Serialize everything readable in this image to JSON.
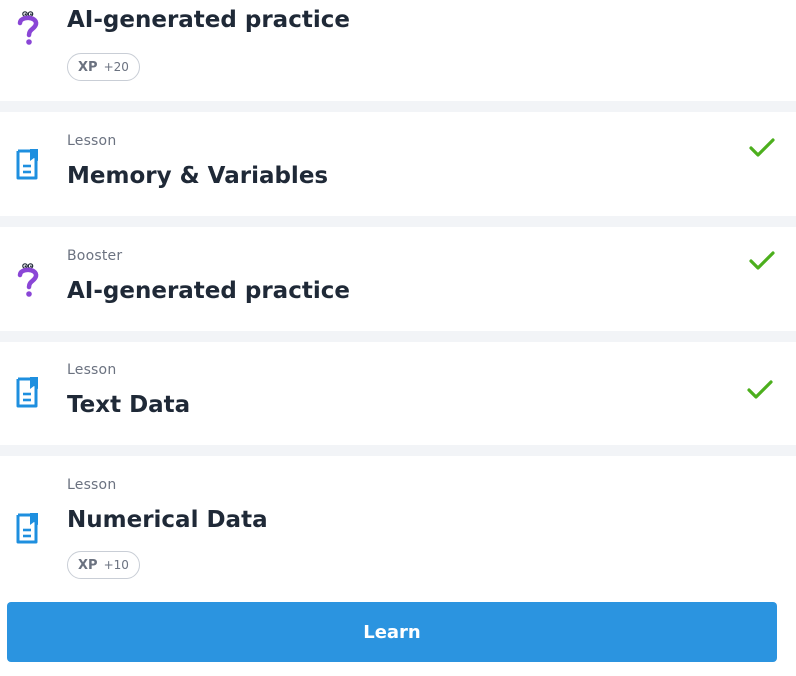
{
  "items": [
    {
      "type": "",
      "title": "AI-generated practice",
      "icon": "booster-question-icon",
      "xp": {
        "label": "XP",
        "value": "+20"
      },
      "completed": false
    },
    {
      "type": "Lesson",
      "title": "Memory & Variables",
      "icon": "lesson-document-icon",
      "completed": true
    },
    {
      "type": "Booster",
      "title": "AI-generated practice",
      "icon": "booster-question-icon",
      "completed": true
    },
    {
      "type": "Lesson",
      "title": "Text Data",
      "icon": "lesson-document-icon",
      "completed": true
    },
    {
      "type": "Lesson",
      "title": "Numerical Data",
      "icon": "lesson-document-icon",
      "xp": {
        "label": "XP",
        "value": "+10"
      },
      "completed": false
    }
  ],
  "learn_button": {
    "label": "Learn"
  },
  "colors": {
    "accent": "#2b94e0",
    "check": "#4caf1d",
    "booster": "#8a46d6",
    "lesson_icon": "#1e8fdf"
  }
}
